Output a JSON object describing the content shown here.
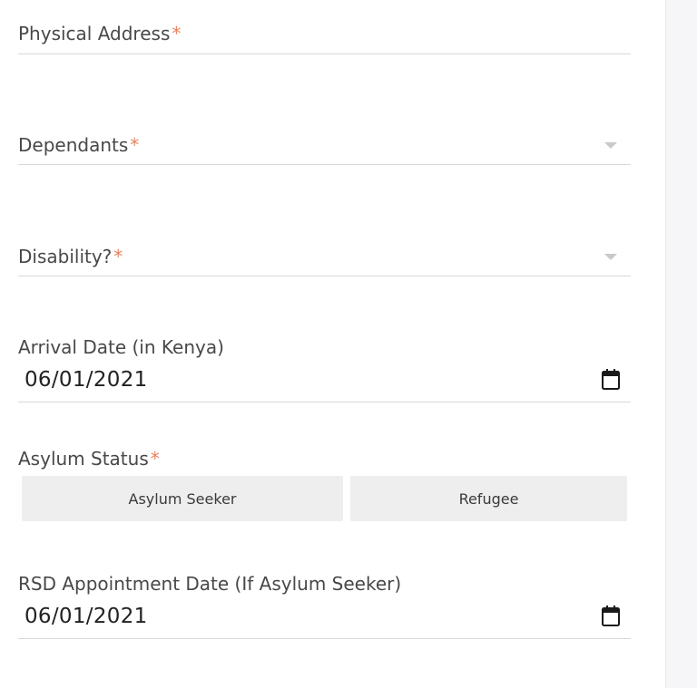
{
  "form": {
    "physical_address": {
      "label": "Physical Address",
      "required_mark": "*",
      "value": ""
    },
    "dependants": {
      "label": "Dependants",
      "required_mark": "*",
      "selected": "",
      "caret_icon": "chevron-down-icon"
    },
    "disability": {
      "label": "Disability?",
      "required_mark": "*",
      "selected": "",
      "caret_icon": "chevron-down-icon"
    },
    "arrival_date": {
      "label": "Arrival Date (in Kenya)",
      "value": "06/01/2021",
      "icon": "calendar-icon"
    },
    "asylum_status": {
      "label": "Asylum Status",
      "required_mark": "*",
      "options": [
        "Asylum Seeker",
        "Refugee"
      ]
    },
    "rsd_appointment_date": {
      "label": "RSD Appointment Date (If Asylum Seeker)",
      "value": "06/01/2021",
      "icon": "calendar-icon"
    }
  },
  "colors": {
    "required_mark": "#e8835e",
    "option_background": "#eeeeee",
    "underline": "#d8d8d8",
    "side_rail": "#f6f6f8"
  }
}
